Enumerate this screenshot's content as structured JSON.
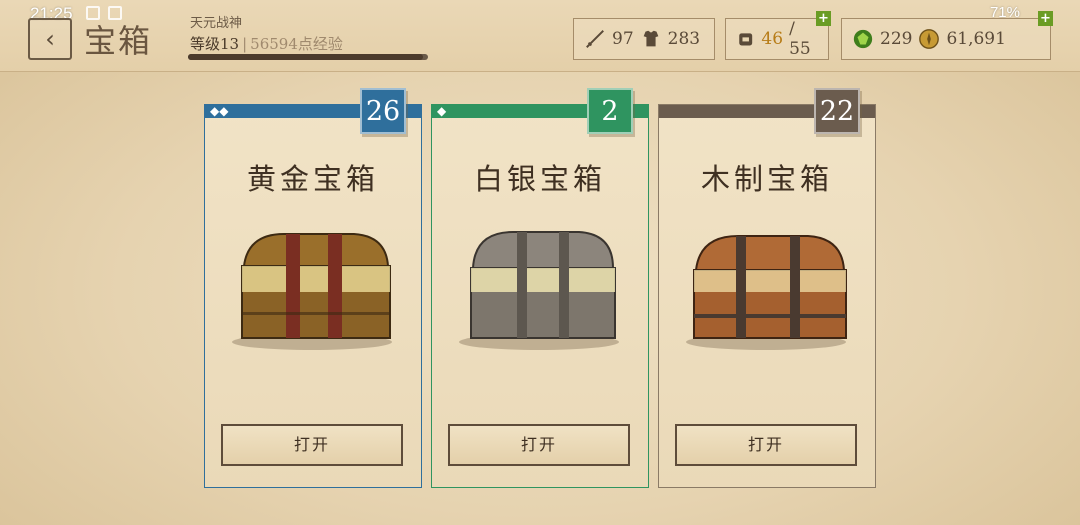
{
  "status_bar": {
    "time": "21:25",
    "battery": "71%"
  },
  "header": {
    "back_icon": "back-chevron-icon",
    "title": "宝箱",
    "player_name": "天元战神",
    "level": "等级13",
    "exp": "56594点经验",
    "exp_progress": 0.98
  },
  "stats": {
    "attack": "97",
    "defense": "283",
    "inventory": "46",
    "inventory_max": "/ 55",
    "gems": "229",
    "coins": "61,691"
  },
  "chests": [
    {
      "name": "黄金宝箱",
      "count": "26",
      "diamonds": "◆◆",
      "color": "#2f6f9c",
      "button": "打开"
    },
    {
      "name": "白银宝箱",
      "count": "2",
      "diamonds": "◆",
      "color": "#2f9460",
      "button": "打开"
    },
    {
      "name": "木制宝箱",
      "count": "22",
      "diamonds": "",
      "color": "#6b5c4e",
      "button": "打开"
    }
  ]
}
